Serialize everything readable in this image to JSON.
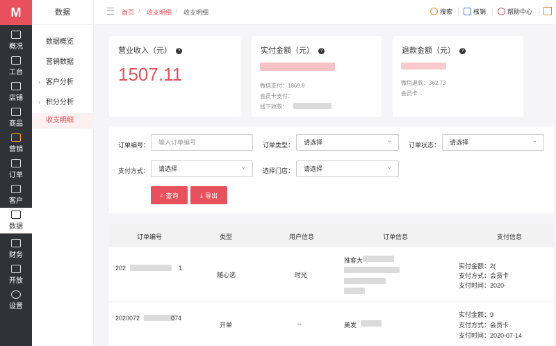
{
  "rail": {
    "items": [
      {
        "label": "概况",
        "icon": "overview-icon"
      },
      {
        "label": "工台",
        "icon": "workbench-icon"
      },
      {
        "label": "店铺",
        "icon": "shop-icon"
      },
      {
        "label": "商品",
        "icon": "goods-icon"
      },
      {
        "label": "营销",
        "icon": "marketing-icon"
      },
      {
        "label": "订单",
        "icon": "order-icon"
      },
      {
        "label": "客户",
        "icon": "customer-icon"
      },
      {
        "label": "数据",
        "icon": "data-icon"
      },
      {
        "label": "财务",
        "icon": "finance-icon"
      },
      {
        "label": "开放",
        "icon": "open-icon"
      },
      {
        "label": "设置",
        "icon": "settings-icon"
      }
    ]
  },
  "sidebar": {
    "title": "数据",
    "items": [
      {
        "label": "数据概览"
      },
      {
        "label": "营销数据"
      },
      {
        "label": "客户分析"
      },
      {
        "label": "积分分析"
      },
      {
        "label": "收支明细"
      }
    ]
  },
  "breadcrumb": {
    "home": "首页",
    "parent": "收支明细",
    "current": "收支明细",
    "sep": "/"
  },
  "toolbar": {
    "search": "搜索",
    "verify": "核销",
    "help": "帮助中心"
  },
  "cards": {
    "revenue": {
      "title": "营业收入（元）",
      "value": "1507.11"
    },
    "paid": {
      "title": "实付金额（元）",
      "wechat": "微信支付：",
      "wechat_val": "1869.8",
      "member": "会员卡支付：",
      "offline": "线下收款："
    },
    "refund": {
      "title": "退款金额（元）",
      "wechat": "微信退款：",
      "wechat_val": "362.73",
      "member": "会员卡..."
    }
  },
  "filters": {
    "order_no_label": "订单编号：",
    "order_no_placeholder": "输入订单编号",
    "order_type_label": "订单类型：",
    "order_status_label": "订单状态：",
    "pay_method_label": "支付方式：",
    "store_label": "选择门店：",
    "select_placeholder": "请选择",
    "query_btn": "查询",
    "export_btn": "导出"
  },
  "table": {
    "headers": [
      "订单编号",
      "类型",
      "用户信息",
      "订单信息",
      "支付信息"
    ],
    "rows": [
      {
        "order_no": "202",
        "order_no_tail": "1",
        "type": "随心选",
        "user": "时光",
        "info": "推客大",
        "pay_amount": "实付金额：",
        "pay_amount_val": "2(",
        "pay_method": "支付方式：",
        "pay_method_val": "会员卡",
        "pay_time": "支付时间：",
        "pay_time_val": "2020-"
      },
      {
        "order_no": "2020072",
        "order_no_tail": "074",
        "type": "开单",
        "user": "--",
        "info": "美发",
        "pay_amount": "实付金额：",
        "pay_amount_val": "9",
        "pay_method": "支付方式：",
        "pay_method_val": "会员卡",
        "pay_time": "支付时间：",
        "pay_time_val": "2020-07-14"
      }
    ]
  },
  "colors": {
    "accent": "#e8505b",
    "rail": "#2f3237"
  }
}
